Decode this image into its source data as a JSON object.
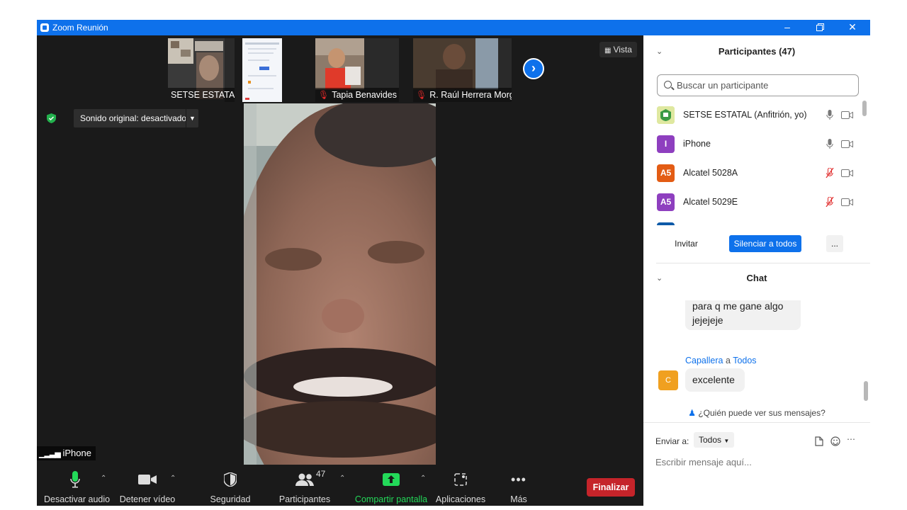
{
  "window": {
    "title": "Zoom Reunión"
  },
  "strip": {
    "thumbs": [
      {
        "name": "SETSE ESTATAL"
      },
      {
        "name": "Tapia Benavides Mari..."
      },
      {
        "name": "R. Raúl Herrera Morg..."
      }
    ],
    "view_label": "Vista"
  },
  "main": {
    "sound_button": "Sonido original: desactivado",
    "speaker_name": "iPhone"
  },
  "toolbar": {
    "mute_label": "Desactivar audio",
    "video_label": "Detener vídeo",
    "security_label": "Seguridad",
    "participants_label": "Participantes",
    "participants_count": "47",
    "share_label": "Compartir pantalla",
    "apps_label": "Aplicaciones",
    "more_label": "Más",
    "end_label": "Finalizar"
  },
  "participants": {
    "header": "Participantes (47)",
    "search_placeholder": "Buscar un participante",
    "list": [
      {
        "name": "SETSE ESTATAL (Anfitrión, yo)",
        "initials": "",
        "color": "#c8d86a",
        "mic": "on"
      },
      {
        "name": "iPhone",
        "initials": "I",
        "color": "#8e3fbf",
        "mic": "on"
      },
      {
        "name": "Alcatel 5028A",
        "initials": "A5",
        "color": "#e35c14",
        "mic": "muted"
      },
      {
        "name": "Alcatel 5029E",
        "initials": "A5",
        "color": "#8e3fbf",
        "mic": "muted"
      }
    ],
    "invite_label": "Invitar",
    "mute_all_label": "Silenciar a todos",
    "more_label": "..."
  },
  "chat": {
    "header": "Chat",
    "messages": [
      {
        "text_line1": "para q me gane algo",
        "text_line2": "jejejeje"
      },
      {
        "sender": "Capallera",
        "to_word": "a",
        "recipient": "Todos",
        "initial": "C",
        "text": "excelente"
      }
    ],
    "who_can_see": "¿Quién puede ver sus mensajes?",
    "send_to_label": "Enviar a:",
    "send_to_value": "Todos",
    "input_placeholder": "Escribir mensaje aquí..."
  },
  "colors": {
    "zoom_blue": "#0e71eb",
    "end_red": "#c5242a",
    "share_green": "#23d959",
    "muted_red": "#e02828",
    "link_blue": "#0e71eb"
  }
}
